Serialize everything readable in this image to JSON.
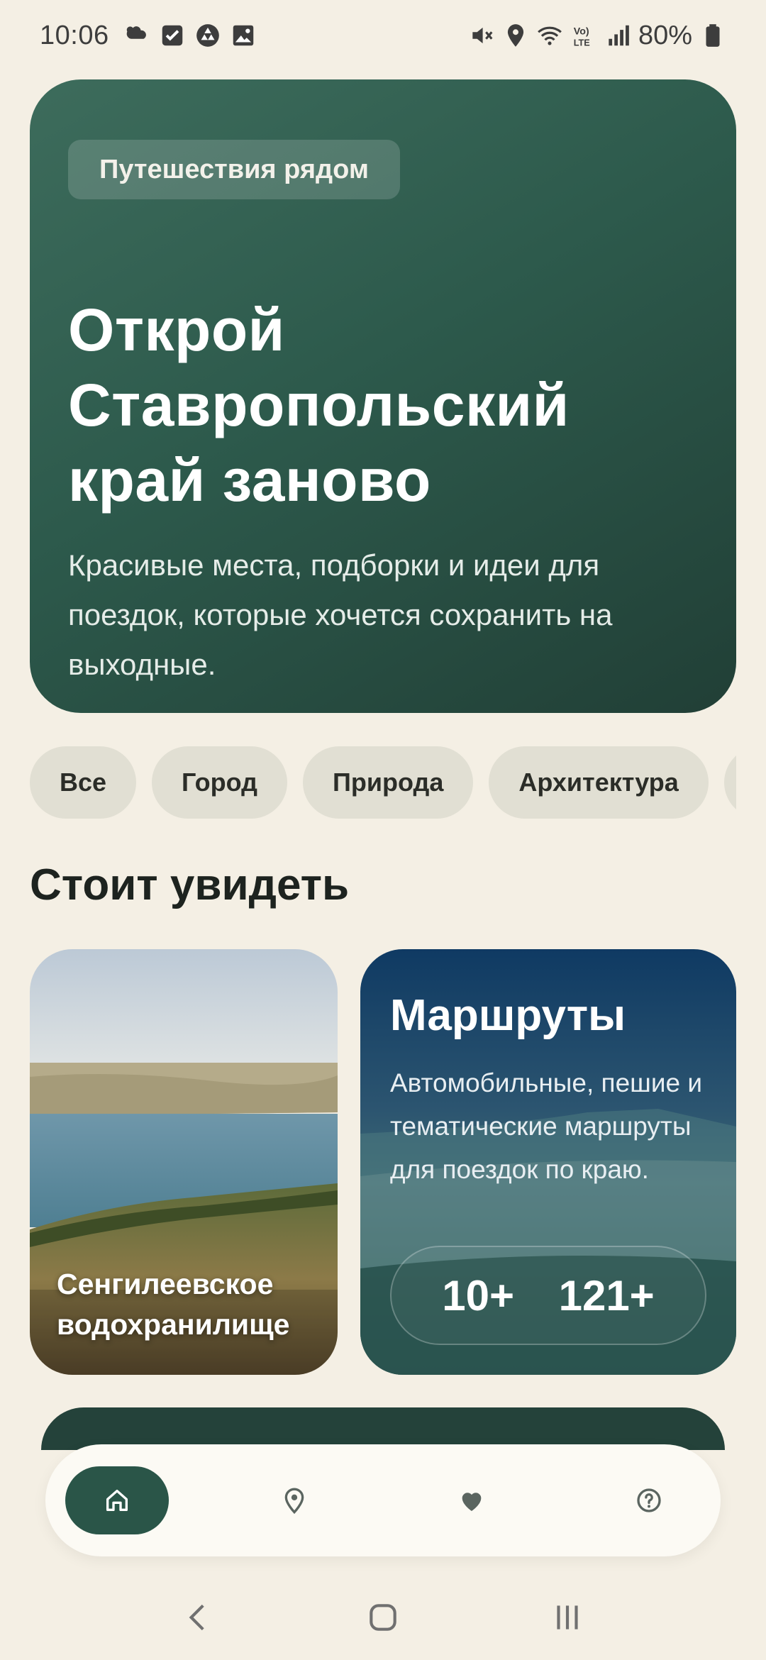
{
  "status_bar": {
    "time": "10:06",
    "battery": "80%",
    "left_icons": [
      "weather-icon",
      "checkbox-icon",
      "recycle-icon",
      "gallery-icon"
    ],
    "right_icons": [
      "mute-icon",
      "location-icon",
      "wifi-icon",
      "volte-icon",
      "signal-icon",
      "battery-icon"
    ]
  },
  "hero": {
    "badge": "Путешествия рядом",
    "title": "Открой Ставропольский край заново",
    "subtitle": "Красивые места, подборки и идеи для поездок, которые хочется сохранить на выходные."
  },
  "chips": [
    {
      "label": "Все"
    },
    {
      "label": "Город"
    },
    {
      "label": "Природа"
    },
    {
      "label": "Архитектура"
    }
  ],
  "section": {
    "title": "Стоит увидеть"
  },
  "place_card": {
    "name": "Сенгилеевское водохранилище"
  },
  "routes_card": {
    "title": "Маршруты",
    "description": "Автомобильные, пешие и тематические маршруты для поездок по краю.",
    "stat_1": "10+",
    "stat_2": "121+"
  },
  "bottom_nav": {
    "items": [
      {
        "icon": "home-icon",
        "active": true
      },
      {
        "icon": "map-pin-icon",
        "active": false
      },
      {
        "icon": "heart-icon",
        "active": false
      },
      {
        "icon": "help-icon",
        "active": false
      }
    ]
  },
  "colors": {
    "background": "#f4efe4",
    "hero_green": "#2d5a4c",
    "accent": "#2a5548",
    "chip": "#e1dfd3",
    "routes_blue": "#0f3a63"
  }
}
